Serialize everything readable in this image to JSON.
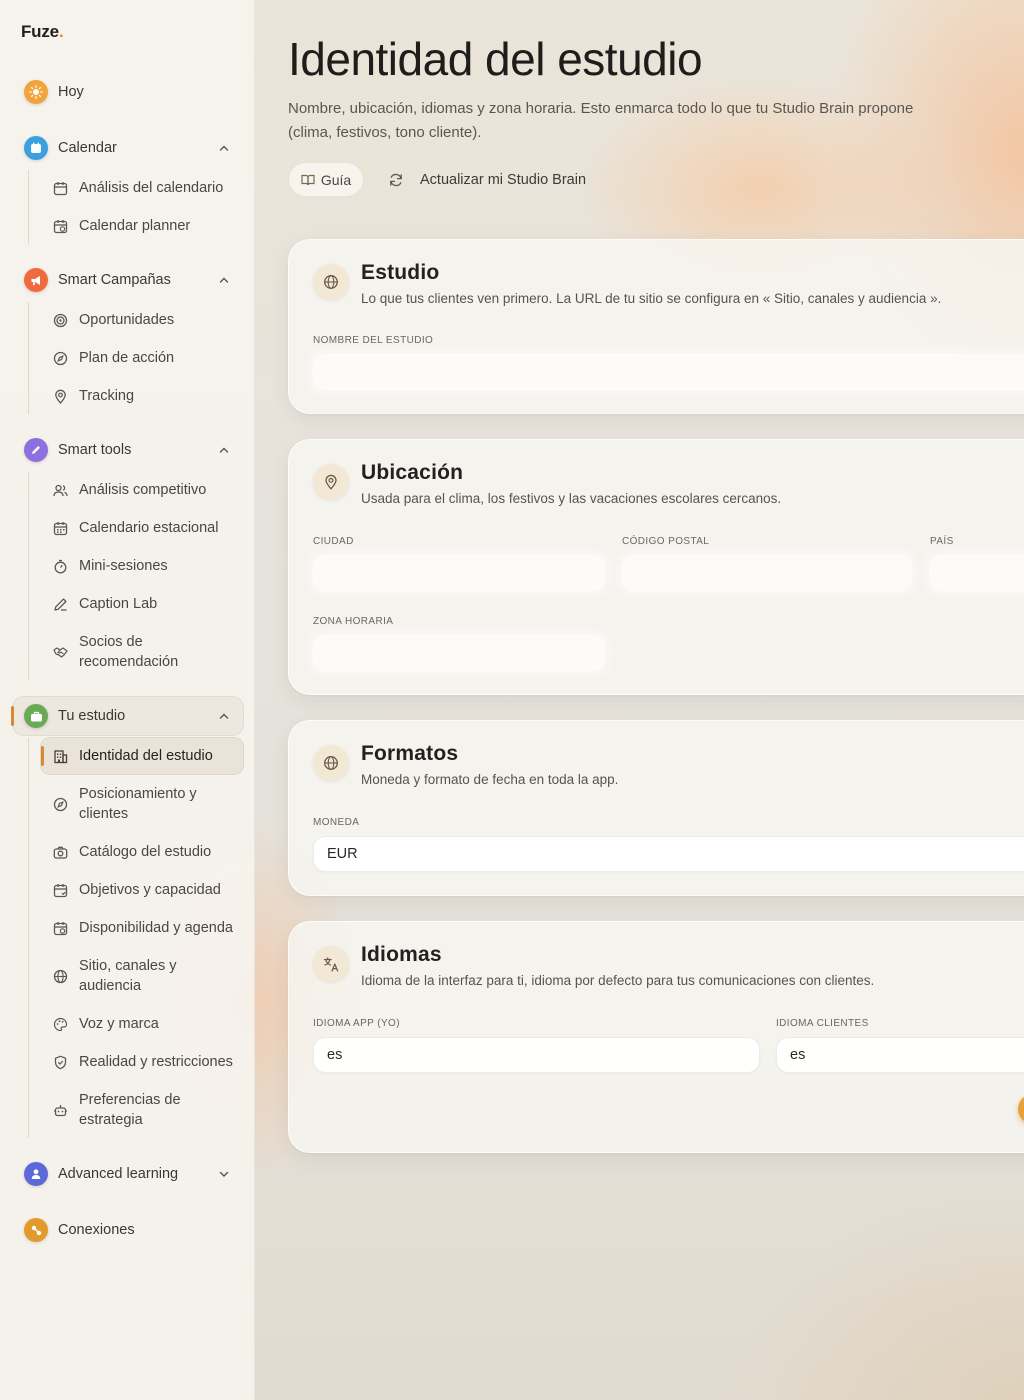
{
  "app": {
    "brand": "Fuze",
    "brand_dot": "."
  },
  "colors": {
    "accent": "#d98a2e",
    "hoy": "#f0a43a",
    "calendar": "#3aa0e0",
    "campaigns": "#ef6b3e",
    "tools": "#8e6fe0",
    "studio": "#6aaa54",
    "learning": "#5b6ad8",
    "connections": "#e39a2c"
  },
  "sidebar": {
    "hoy": {
      "label": "Hoy",
      "icon": "sun-icon"
    },
    "calendar": {
      "label": "Calendar",
      "icon": "calendar-icon",
      "items": [
        {
          "label": "Análisis del calendario",
          "icon": "calendar-icon"
        },
        {
          "label": "Calendar planner",
          "icon": "calendar-clock-icon"
        }
      ]
    },
    "campaigns": {
      "label": "Smart Campañas",
      "icon": "megaphone-icon",
      "items": [
        {
          "label": "Oportunidades",
          "icon": "target-icon"
        },
        {
          "label": "Plan de acción",
          "icon": "compass-icon"
        },
        {
          "label": "Tracking",
          "icon": "map-pin-icon"
        }
      ]
    },
    "tools": {
      "label": "Smart tools",
      "icon": "pen-icon",
      "items": [
        {
          "label": "Análisis competitivo",
          "icon": "users-icon"
        },
        {
          "label": "Calendario estacional",
          "icon": "calendar-grid-icon"
        },
        {
          "label": "Mini-sesiones",
          "icon": "timer-icon"
        },
        {
          "label": "Caption Lab",
          "icon": "pencil-icon"
        },
        {
          "label_line1": "Socios de",
          "label_line2": "recomendación",
          "icon": "handshake-icon"
        }
      ]
    },
    "studio": {
      "label": "Tu estudio",
      "icon": "briefcase-icon",
      "items": [
        {
          "label": "Identidad del estudio",
          "icon": "building-icon"
        },
        {
          "label_line1": "Posicionamiento y",
          "label_line2": "clientes",
          "icon": "compass-icon"
        },
        {
          "label": "Catálogo del estudio",
          "icon": "camera-icon"
        },
        {
          "label": "Objetivos y capacidad",
          "icon": "calendar-check-icon"
        },
        {
          "label": "Disponibilidad y agenda",
          "icon": "calendar-clock-icon"
        },
        {
          "label_line1": "Sitio, canales y",
          "label_line2": "audiencia",
          "icon": "globe-icon"
        },
        {
          "label": "Voz y marca",
          "icon": "palette-icon"
        },
        {
          "label": "Realidad y restricciones",
          "icon": "shield-check-icon"
        },
        {
          "label_line1": "Preferencias de",
          "label_line2": "estrategia",
          "icon": "robot-icon"
        }
      ]
    },
    "learning": {
      "label": "Advanced learning",
      "icon": "person-icon"
    },
    "connections": {
      "label": "Conexiones",
      "icon": "link-icon"
    }
  },
  "main": {
    "title": "Identidad del estudio",
    "subtitle_line1": "Nombre, ubicación, idiomas y zona horaria. Esto enmarca todo lo que tu Studio Brain propone",
    "subtitle_line2": "(clima, festivos, tono cliente).",
    "guide_button": "Guía",
    "refresh_button": "Actualizar mi Studio Brain",
    "cards": {
      "studio": {
        "title": "Estudio",
        "desc": "Lo que tus clientes ven primero. La URL de tu sitio se configura en « Sitio, canales y audiencia ».",
        "name_label": "Nombre del estudio",
        "name_value": ""
      },
      "location": {
        "title": "Ubicación",
        "desc": "Usada para el clima, los festivos y las vacaciones escolares cercanos.",
        "city_label": "Ciudad",
        "postal_label": "Código postal",
        "country_label": "País",
        "timezone_label": "Zona horaria"
      },
      "formats": {
        "title": "Formatos",
        "desc": "Moneda y formato de fecha en toda la app.",
        "currency_label": "Moneda",
        "currency_value": "EUR"
      },
      "languages": {
        "title": "Idiomas",
        "desc": "Idioma de la interfaz para ti, idioma por defecto para tus comunicaciones con clientes.",
        "app_lang_label": "Idioma app (yo)",
        "app_lang_value": "es",
        "client_lang_label": "Idioma clientes",
        "client_lang_value": "es"
      }
    }
  }
}
